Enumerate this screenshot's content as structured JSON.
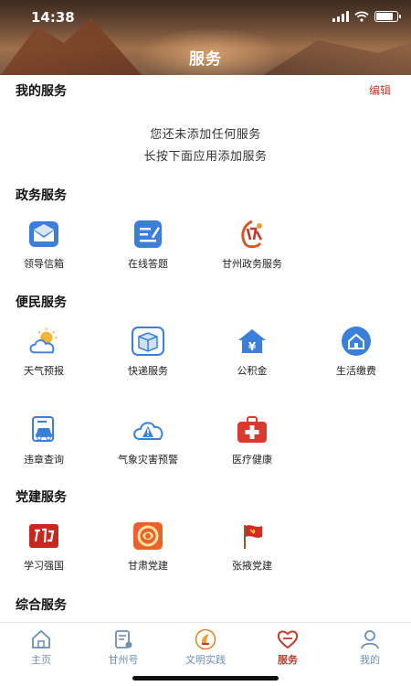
{
  "status_bar": {
    "time": "14:38"
  },
  "header": {
    "title": "服务"
  },
  "my_services": {
    "title": "我的服务",
    "edit_label": "编辑",
    "empty_line1": "您还未添加任何服务",
    "empty_line2": "长按下面应用添加服务"
  },
  "gov_services": {
    "title": "政务服务",
    "items": [
      {
        "label": "领导信箱",
        "icon": "envelope-icon"
      },
      {
        "label": "在线答题",
        "icon": "edit-document-icon"
      },
      {
        "label": "甘州政务服务",
        "icon": "gov-emblem-icon"
      }
    ]
  },
  "civil_services": {
    "title": "便民服务",
    "items": [
      {
        "label": "天气预报",
        "icon": "weather-icon"
      },
      {
        "label": "快递服务",
        "icon": "package-icon"
      },
      {
        "label": "公积金",
        "icon": "housing-fund-icon"
      },
      {
        "label": "生活缴费",
        "icon": "home-bill-icon"
      },
      {
        "label": "违章查询",
        "icon": "car-violation-icon"
      },
      {
        "label": "气象灾害预警",
        "icon": "weather-alert-icon"
      },
      {
        "label": "医疗健康",
        "icon": "medical-kit-icon"
      }
    ]
  },
  "party_services": {
    "title": "党建服务",
    "items": [
      {
        "label": "学习强国",
        "icon": "xuexi-icon"
      },
      {
        "label": "甘肃党建",
        "icon": "gansu-party-icon"
      },
      {
        "label": "张掖党建",
        "icon": "party-flag-icon"
      }
    ]
  },
  "general_services": {
    "title": "综合服务"
  },
  "tabbar": {
    "active_color": "#c23b2f",
    "inactive_color": "#6b8fb5",
    "items": [
      {
        "label": "主页",
        "icon": "home-icon",
        "active": false
      },
      {
        "label": "甘州号",
        "icon": "account-icon",
        "active": false
      },
      {
        "label": "文明实践",
        "icon": "civilization-icon",
        "active": false
      },
      {
        "label": "服务",
        "icon": "service-heart-icon",
        "active": true
      },
      {
        "label": "我的",
        "icon": "user-icon",
        "active": false
      }
    ]
  }
}
